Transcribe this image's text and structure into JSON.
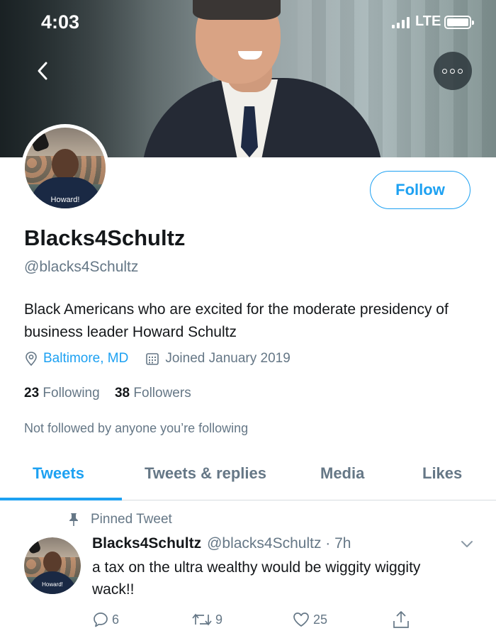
{
  "status_bar": {
    "time": "4:03",
    "network": "LTE"
  },
  "header": {
    "back_icon": "chevron-left-icon",
    "more_icon": "more-horizontal-icon"
  },
  "profile": {
    "avatar_caption": "Howard!",
    "display_name": "Blacks4Schultz",
    "handle": "@blacks4Schultz",
    "follow_label": "Follow",
    "bio": "Black Americans who are excited for the moderate presidency of business leader Howard Schultz",
    "location": "Baltimore, MD",
    "joined": "Joined January 2019",
    "following_count": "23",
    "following_label": "Following",
    "followers_count": "38",
    "followers_label": "Followers",
    "not_followed_text": "Not followed by anyone you’re following"
  },
  "tabs": [
    {
      "label": "Tweets",
      "active": true
    },
    {
      "label": "Tweets & replies",
      "active": false
    },
    {
      "label": "Media",
      "active": false
    },
    {
      "label": "Likes",
      "active": false
    }
  ],
  "pinned_tweet": {
    "pinned_label": "Pinned Tweet",
    "author_name": "Blacks4Schultz",
    "author_meta": "@blacks4Schultz · 7h",
    "avatar_caption": "Howard!",
    "text": "a tax on the ultra wealthy would be wiggity wiggity wack!!",
    "replies": "6",
    "retweets": "9",
    "likes": "25"
  },
  "colors": {
    "accent": "#1da1f2",
    "secondary_text": "#657786",
    "primary_text": "#14171a"
  }
}
